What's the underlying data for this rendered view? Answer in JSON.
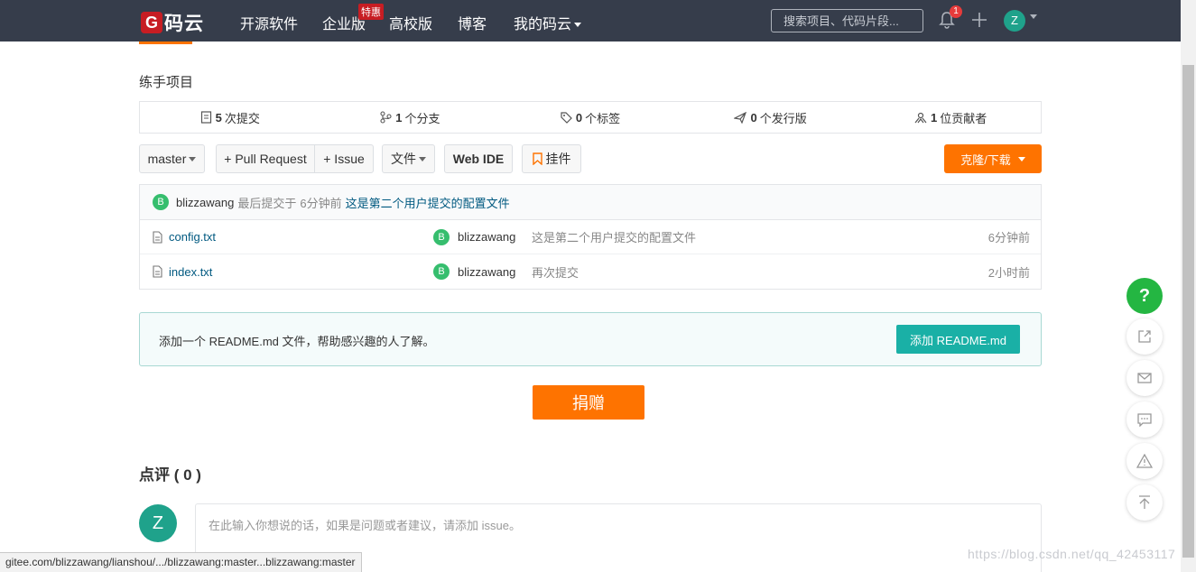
{
  "nav": {
    "logo_mark": "G",
    "logo_text": "码云",
    "links": [
      "开源软件",
      "企业版",
      "高校版",
      "博客",
      "我的码云"
    ],
    "hot_badge": "特惠",
    "search_placeholder": "搜索项目、代码片段...",
    "notification_count": "1",
    "user_initial": "Z"
  },
  "repo": {
    "description": "练手项目",
    "stats": [
      {
        "icon": "commit-icon",
        "count": "5",
        "label": "次提交"
      },
      {
        "icon": "branch-icon",
        "count": "1",
        "label": "个分支"
      },
      {
        "icon": "tag-icon",
        "count": "0",
        "label": "个标签"
      },
      {
        "icon": "release-icon",
        "count": "0",
        "label": "个发行版"
      },
      {
        "icon": "contributor-icon",
        "count": "1",
        "label": "位贡献者"
      }
    ],
    "toolbar": {
      "branch": "master",
      "pull_request": "+ Pull Request",
      "issue": "+ Issue",
      "file": "文件",
      "web_ide": "Web IDE",
      "widget": "挂件",
      "clone": "克隆/下载"
    },
    "last_commit": {
      "avatar": "B",
      "author": "blizzawang",
      "prefix": "最后提交于",
      "time": "6分钟前",
      "message": "这是第二个用户提交的配置文件"
    },
    "files": [
      {
        "name": "config.txt",
        "avatar": "B",
        "author": "blizzawang",
        "message": "这是第二个用户提交的配置文件",
        "time": "6分钟前"
      },
      {
        "name": "index.txt",
        "avatar": "B",
        "author": "blizzawang",
        "message": "再次提交",
        "time": "2小时前"
      }
    ],
    "readme": {
      "text": "添加一个 README.md 文件，帮助感兴趣的人了解。",
      "button": "添加 README.md"
    },
    "donate": "捐赠"
  },
  "comments": {
    "title": "点评 ( 0 )",
    "avatar": "Z",
    "placeholder": "在此输入你想说的话，如果是问题或者建议，请添加 issue。"
  },
  "float_buttons": [
    "help-icon",
    "edit-icon",
    "mail-icon",
    "chat-icon",
    "warning-icon",
    "back-to-top-icon"
  ],
  "float_help_label": "?",
  "statusbar": "gitee.com/blizzawang/lianshou/.../blizzawang:master...blizzawang:master",
  "watermark": "https://blog.csdn.net/qq_42453117",
  "colors": {
    "nav_bg": "#363d4b",
    "accent_orange": "#fe7300",
    "brand_red": "#c71d23",
    "teal": "#1ab0a6",
    "green": "#36be6e"
  }
}
